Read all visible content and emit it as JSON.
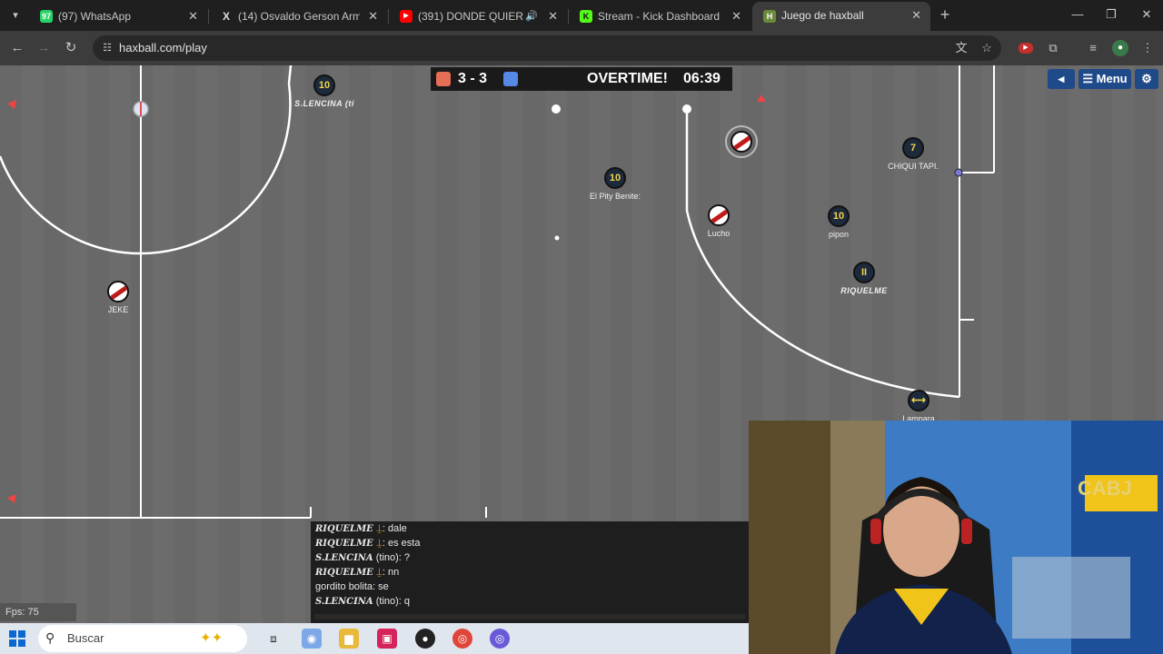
{
  "browser": {
    "tabs": [
      {
        "title": "(97) WhatsApp",
        "favicon": "whatsapp-icon",
        "badge": "97",
        "color": "#25d366",
        "active": false
      },
      {
        "title": "(14) Osvaldo Gerson Armiento",
        "favicon": "x-icon",
        "color": "#000000",
        "active": false
      },
      {
        "title": "(391) DONDE QUIERO ESTAR",
        "favicon": "youtube-icon",
        "color": "#ff0000",
        "active": false,
        "audio": true
      },
      {
        "title": "Stream - Kick Dashboard",
        "favicon": "kick-icon",
        "color": "#53fc18",
        "active": false
      },
      {
        "title": "Juego de haxball",
        "favicon": "haxball-icon",
        "color": "#6a8a3a",
        "active": true
      }
    ],
    "url": "haxball.com/play"
  },
  "game": {
    "scoreboard": {
      "red_score": "3",
      "separator": "-",
      "blue_score": "3",
      "status": "OVERTIME!",
      "time": "06:39",
      "red_color": "#e56e56",
      "blue_color": "#5689e5"
    },
    "buttons": {
      "back": "◂",
      "menu": "☰ Menu",
      "settings": "⚙"
    },
    "players": [
      {
        "team": "blue",
        "number": "10",
        "name": "S.LENCINA (ti",
        "italic": true
      },
      {
        "team": "blue",
        "number": "10",
        "name": "El Pity Benite:",
        "italic": false
      },
      {
        "team": "blue",
        "number": "7",
        "name": "CHIQUI TAPI.",
        "italic": false
      },
      {
        "team": "blue",
        "number": "10",
        "name": "pipon",
        "italic": false
      },
      {
        "team": "blue",
        "number": "II",
        "name": "RIQUELME",
        "italic": true
      },
      {
        "team": "blue",
        "number": "⟷",
        "name": "Lampara",
        "italic": false
      },
      {
        "team": "red",
        "number": "",
        "name": "",
        "italic": false
      },
      {
        "team": "red",
        "number": "",
        "name": "Lucho",
        "italic": false
      },
      {
        "team": "red",
        "number": "",
        "name": "JEKE",
        "italic": false
      }
    ],
    "fps": "Fps: 75",
    "chat": [
      {
        "nick": "RIQUELME ",
        "badge": "⍊",
        "message": ": dale"
      },
      {
        "nick": "RIQUELME ",
        "badge": "⍊",
        "message": ": es esta"
      },
      {
        "nick": "S.LENCINA",
        "badge": "",
        "message": " (tino): ?"
      },
      {
        "nick": "RIQUELME ",
        "badge": "⍊",
        "message": ": nn"
      },
      {
        "nick": "",
        "badge": "",
        "message": "gordito bolita: se"
      },
      {
        "nick": "S.LENCINA",
        "badge": "",
        "message": " (tino): q"
      }
    ]
  },
  "taskbar": {
    "search_placeholder": "Buscar"
  }
}
